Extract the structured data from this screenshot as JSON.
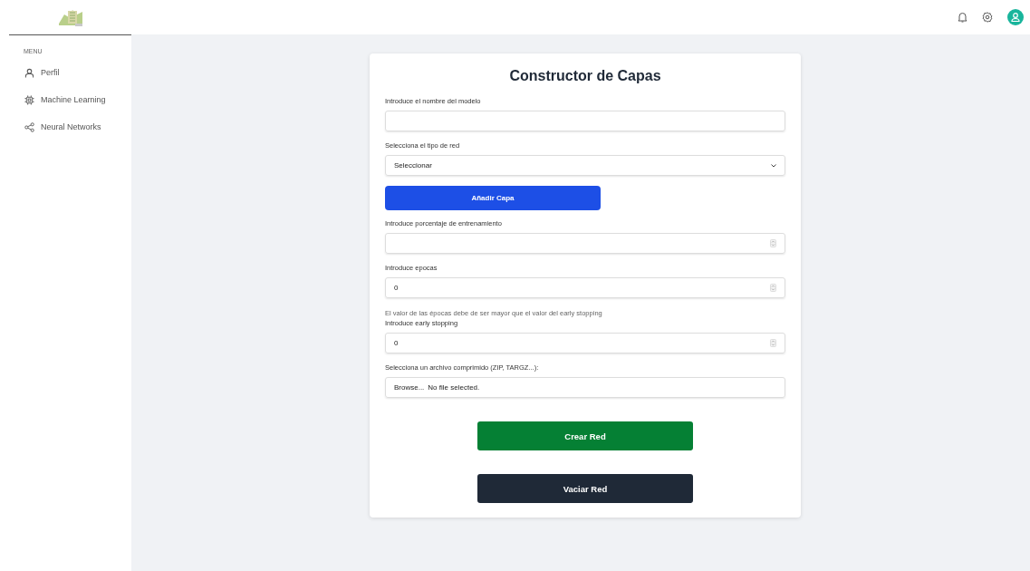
{
  "sidebar": {
    "menu_heading": "MENU",
    "items": [
      {
        "label": "Perfil",
        "selected": false
      },
      {
        "label": "Machine Learning",
        "selected": false
      },
      {
        "label": "Neural Networks",
        "selected": false
      }
    ]
  },
  "form": {
    "title": "Constructor de Capas",
    "fields": [
      {
        "kind": "text",
        "label": "Introduce el nombre del modelo"
      },
      {
        "kind": "select",
        "label": "Selecciona el tipo de red",
        "value": "Seleccionar"
      },
      {
        "kind": "button",
        "label": "Añadir Capa"
      },
      {
        "kind": "number",
        "label": "Introduce porcentaje de entrenamiento"
      },
      {
        "kind": "number",
        "label": "Introduce epocas",
        "value": "0"
      },
      {
        "kind": "hint",
        "label": "El valor de las épocas debe de ser mayor que el valor del early stopping"
      },
      {
        "kind": "number",
        "label": "Introduce early stopping",
        "value": "0"
      },
      {
        "kind": "file",
        "label": "Selecciona un archivo comprimido (ZIP, TARGZ...):",
        "button": "Browse...",
        "status": "No file selected."
      }
    ],
    "actions": [
      {
        "label": "Crear Red",
        "kind": "primary"
      },
      {
        "label": "Vaciar Red",
        "kind": "dark"
      }
    ]
  }
}
